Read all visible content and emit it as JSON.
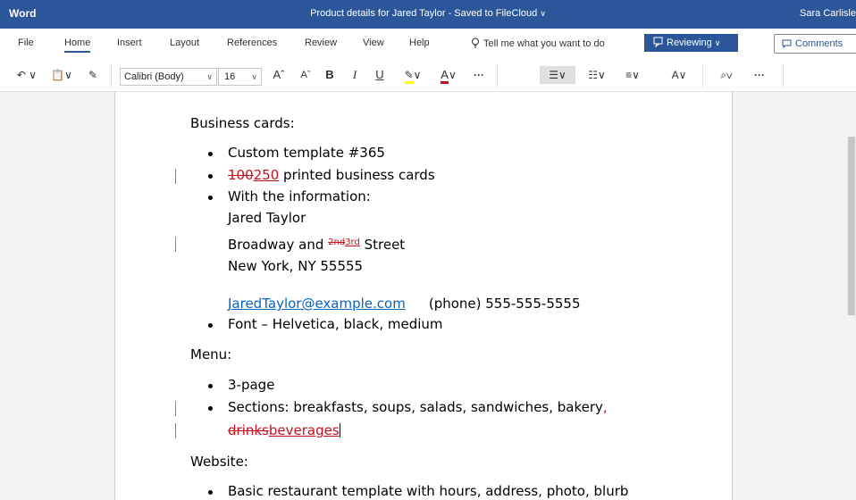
{
  "titlebar": {
    "app": "Word",
    "doc_title": "Product details for Jared Taylor - Saved to FileCloud",
    "user": "Sara Carlisle"
  },
  "tabs": [
    "File",
    "Home",
    "Insert",
    "Layout",
    "References",
    "Review",
    "View",
    "Help"
  ],
  "active_tab": "Home",
  "tell_me": "Tell me what you want to do",
  "reviewing": "Reviewing",
  "comments": "Comments",
  "toolbar": {
    "font_name": "Calibri (Body)",
    "font_size": "16",
    "more": "···"
  },
  "colors": {
    "title_blue": "#2b579a",
    "track_change_red": "#c50f1f",
    "link_blue": "#0563c1",
    "highlight_yellow": "#ffff00"
  },
  "doc": {
    "business_heading": "Business cards:",
    "b1": "Custom template #365",
    "b2_del": "100",
    "b2_ins": "250",
    "b2_rest": " printed business cards",
    "b3": "With the information:",
    "info_name": "Jared Taylor",
    "addr_pre": "Broadway and ",
    "addr_del": "2nd",
    "addr_ins": "3rd",
    "addr_post": " Street",
    "addr_city": "New York, NY 55555",
    "email": "JaredTaylor@example.com",
    "phone": "(phone) 555-555-5555",
    "font_line": "Font – Helvetica, black, medium",
    "menu_heading": "Menu:",
    "m1": "3-page",
    "m2": "Sections: breakfasts, soups, salads, sandwiches, bakery",
    "m2_comma": ",",
    "m2_del": "drinks",
    "m2_ins": "beverages",
    "website_heading": "Website:",
    "w1": "Basic restaurant template with hours, address, photo, blurb"
  }
}
